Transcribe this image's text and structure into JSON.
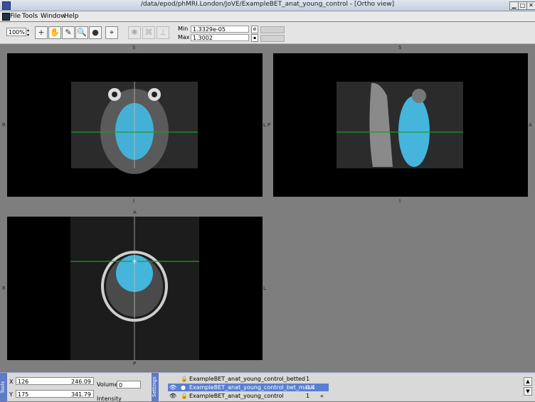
{
  "window": {
    "title": "/data/epod/phMRI.London/JoVE/ExampleBET_anat_young_control - [Ortho view]"
  },
  "menu": {
    "file": "File",
    "tools": "Tools",
    "window": "Window",
    "help": "Help"
  },
  "toolbar": {
    "zoom": "100%",
    "min_label": "Min",
    "min_value": "1.3329e-05",
    "max_label": "Max",
    "max_value": "1.3002"
  },
  "views": {
    "coronal": {
      "top": "S",
      "bottom": "I",
      "left": "R",
      "right": "L"
    },
    "sagittal": {
      "top": "S",
      "bottom": "I",
      "left": "P",
      "right": "A"
    },
    "axial": {
      "top": "A",
      "bottom": "P",
      "left": "R",
      "right": "L"
    }
  },
  "bottom": {
    "tools_tab": "Tools",
    "settings_tab": "Settings",
    "x_label": "X",
    "x_voxel": "126",
    "x_mm": "246.09",
    "y_label": "Y",
    "y_voxel": "175",
    "y_mm": "341.79",
    "volume_label": "Volume",
    "volume_value": "0",
    "intensity_label": "Intensity",
    "overlays": [
      {
        "name": "ExampleBET_anat_young_control_betted",
        "value": "1"
      },
      {
        "name": "ExampleBET_anat_young_control_bet_mask",
        "value": "0.4"
      },
      {
        "name": "ExampleBET_anat_young_control",
        "value": "1"
      }
    ]
  },
  "colors": {
    "mask": "#45b5dc",
    "crosshair": "#1f9a2a",
    "selection": "#5a7fd0"
  }
}
